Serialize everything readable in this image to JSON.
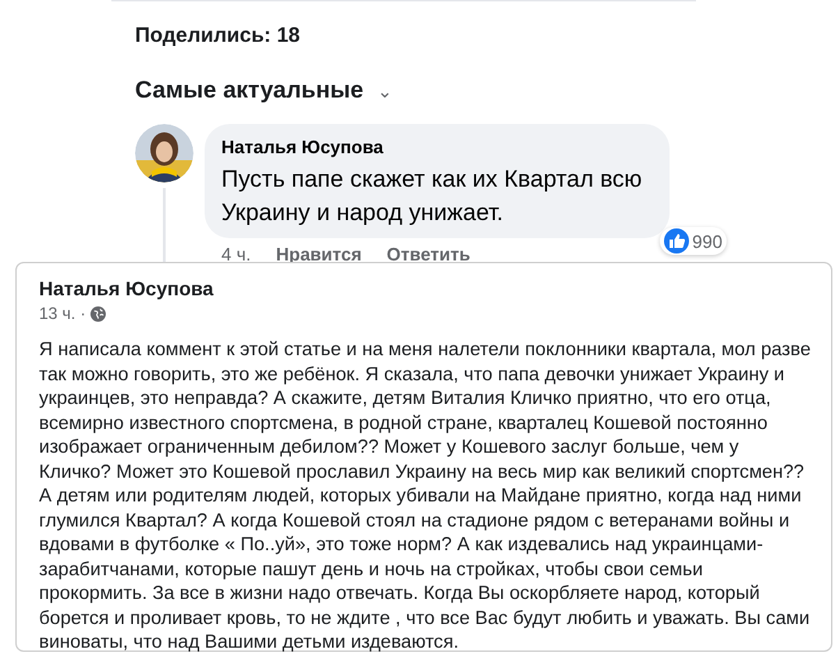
{
  "shares": "Поделились: 18",
  "sort": {
    "label": "Самые актуальные",
    "caret": "⌄"
  },
  "comment": {
    "author": "Наталья Юсупова",
    "text": "Пусть папе скажет как их Квартал всю Украину и народ унижает.",
    "time": "4 ч.",
    "actions": [
      "Нравится",
      "Ответить"
    ],
    "reactions": "990"
  },
  "post": {
    "author": "Наталья Юсупова",
    "time": "13 ч. ·",
    "text": "Я написала коммент к этой статье и на меня налетели поклонники квартала, мол разве так можно говорить, это же ребёнок. Я сказала, что папа девочки унижает Украину и украинцев, это неправда? А скажите, детям Виталия Кличко приятно, что его отца, всемирно известного спортсмена, в родной стране, кварталец Кошевой постоянно изображает ограниченным дебилом?? Может у Кошевого заслуг больше, чем у Кличко? Может это Кошевой прославил Украину на весь мир как великий спортсмен?? А детям или родителям людей, которых убивали на Майдане приятно, когда над ними глумился Квартал? А когда Кошевой стоял на стадионе рядом с ветеранами войны и вдовами в футболке « По..уй», это тоже норм? А как издевались над украинцами-зарабитчанами, которые пашут день и ночь на стройках, чтобы свои семьи прокормить. За все в жизни надо отвечать. Когда Вы оскорбляете народ, который борется и проливает кровь, то не ждите , что все Вас будут любить и уважать. Вы сами виноваты, что над Вашими детьми издеваются."
  }
}
